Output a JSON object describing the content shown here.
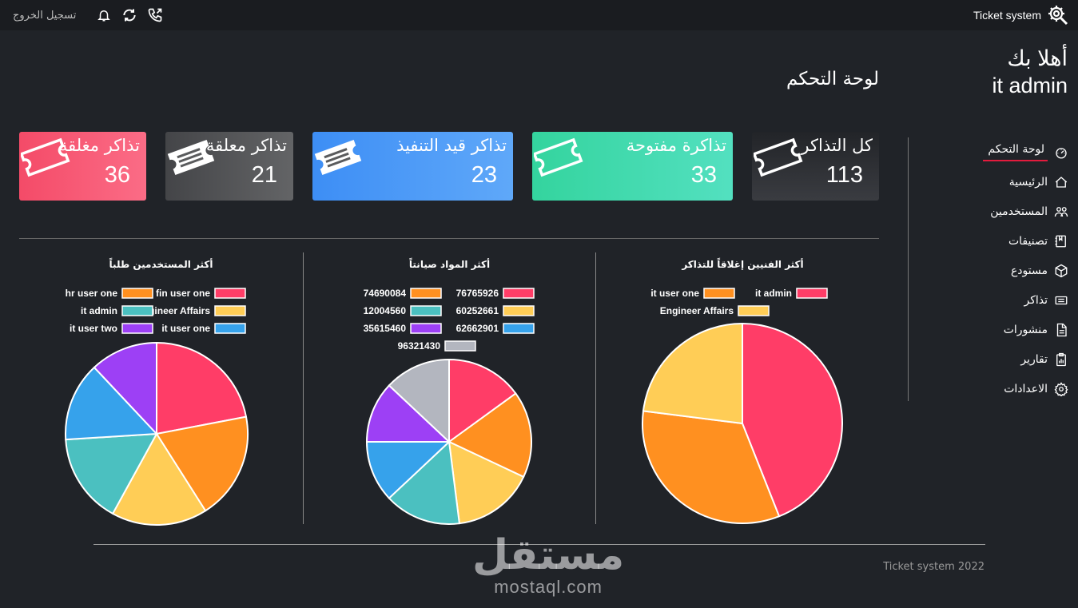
{
  "topbar": {
    "app_name": "Ticket system",
    "logout_label": "تسجيل الخروج"
  },
  "welcome": {
    "greeting": "أهلا بك",
    "user": "it admin"
  },
  "page_title": "لوحة التحكم",
  "sidebar": {
    "items": [
      {
        "label": "لوحة التحكم",
        "icon": "speedometer-icon",
        "active": true
      },
      {
        "label": "الرئيسية",
        "icon": "home-icon"
      },
      {
        "label": "المستخدمين",
        "icon": "users-icon"
      },
      {
        "label": "تصنيفات",
        "icon": "categories-icon"
      },
      {
        "label": "مستودع",
        "icon": "box-icon"
      },
      {
        "label": "تذاكر",
        "icon": "ticket-icon"
      },
      {
        "label": "منشورات",
        "icon": "document-icon"
      },
      {
        "label": "تقارير",
        "icon": "report-icon"
      },
      {
        "label": "الاعدادات",
        "icon": "gear-icon"
      }
    ]
  },
  "stats": [
    {
      "title": "كل التذاكر",
      "value": "113",
      "color": "#2a2c30"
    },
    {
      "title": "تذاكرة مفتوحة",
      "value": "33",
      "color": "#3fd7a6"
    },
    {
      "title": "تذاكر قيد التنفيذ",
      "value": "23",
      "color": "#4a9cf7"
    },
    {
      "title": "تذاكر معلقة",
      "value": "21",
      "color": "#4f5052"
    },
    {
      "title": "تذاكر مغلقة",
      "value": "36",
      "color": "#f55470"
    }
  ],
  "chart_data": [
    {
      "type": "pie",
      "title": "أكثر المستخدمين طلباً",
      "legend": [
        "fin user one",
        "hr user one",
        "Engineer Affairs",
        "it admin",
        "it user one",
        "it user two"
      ],
      "colors": [
        "#ff3d67",
        "#ff9020",
        "#ffcd56",
        "#4bc0c0",
        "#36a2eb",
        "#9d40f5"
      ],
      "values": [
        22,
        19,
        17,
        16,
        14,
        12
      ]
    },
    {
      "type": "pie",
      "title": "أكثر المواد صيانتاً",
      "legend": [
        "76765926",
        "74690084",
        "60252661",
        "12004560",
        "62662901",
        "35615460",
        "96321430"
      ],
      "colors": [
        "#ff3d67",
        "#ff9020",
        "#ffcd56",
        "#4bc0c0",
        "#36a2eb",
        "#9d40f5",
        "#b3b6bf"
      ],
      "values": [
        15,
        17,
        16,
        15,
        12,
        12,
        13
      ]
    },
    {
      "type": "pie",
      "title": "أكثر الفنيين إغلاقاً للتذاكر",
      "legend": [
        "it admin",
        "it user one",
        "Engineer Affairs"
      ],
      "colors": [
        "#ff3d67",
        "#ff9020",
        "#ffcd56"
      ],
      "values": [
        44,
        33,
        23
      ]
    }
  ],
  "footer": "Ticket system 2022",
  "watermark": {
    "arabic": "مستقل",
    "latin": "mostaql.com"
  }
}
